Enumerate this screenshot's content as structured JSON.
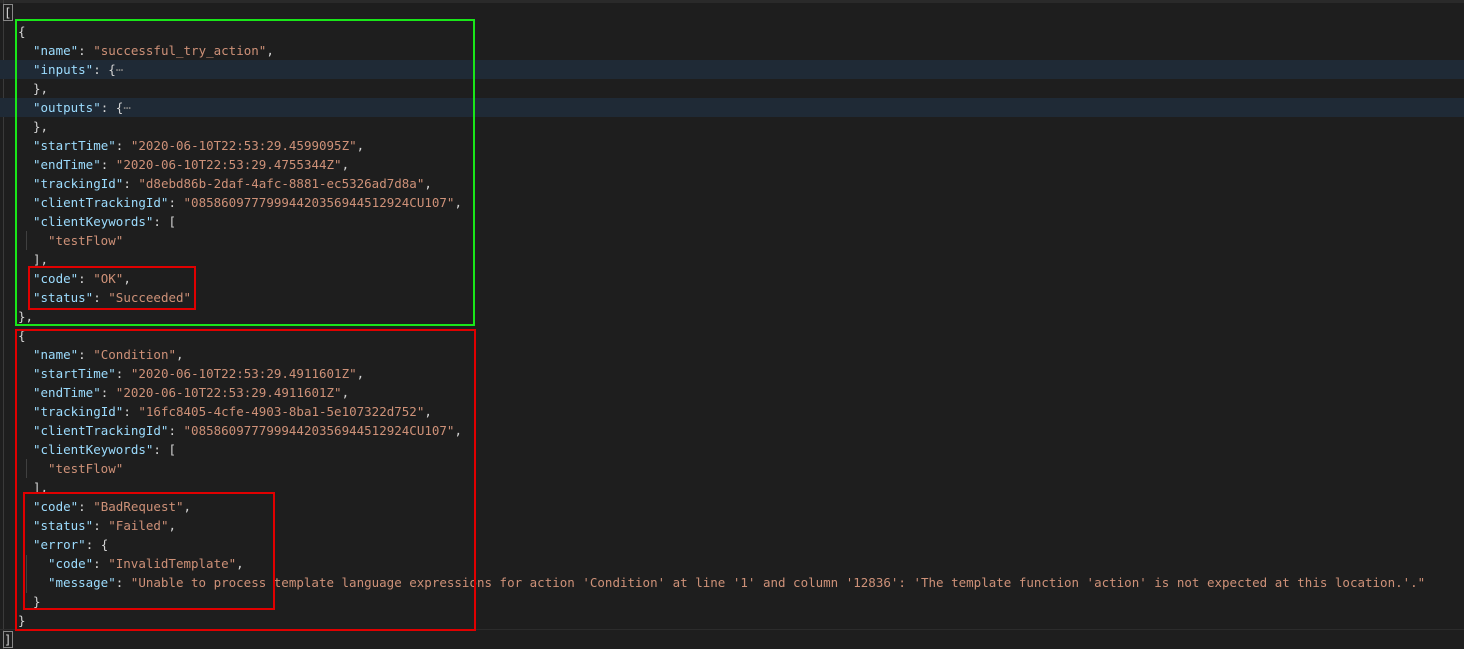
{
  "editor": {
    "open_bracket": "[",
    "close_bracket": "]",
    "fold_ellipsis": "⋯",
    "actions": [
      {
        "name_key": "\"name\"",
        "name_value": "\"successful_try_action\"",
        "inputs_key": "\"inputs\"",
        "outputs_key": "\"outputs\"",
        "startTime_key": "\"startTime\"",
        "startTime_value": "\"2020-06-10T22:53:29.4599095Z\"",
        "endTime_key": "\"endTime\"",
        "endTime_value": "\"2020-06-10T22:53:29.4755344Z\"",
        "trackingId_key": "\"trackingId\"",
        "trackingId_value": "\"d8ebd86b-2daf-4afc-8881-ec5326ad7d8a\"",
        "clientTrackingId_key": "\"clientTrackingId\"",
        "clientTrackingId_value": "\"08586097779994420356944512924CU107\"",
        "clientKeywords_key": "\"clientKeywords\"",
        "clientKeywords_values": [
          "\"testFlow\""
        ],
        "code_key": "\"code\"",
        "code_value": "\"OK\"",
        "status_key": "\"status\"",
        "status_value": "\"Succeeded\""
      },
      {
        "name_key": "\"name\"",
        "name_value": "\"Condition\"",
        "startTime_key": "\"startTime\"",
        "startTime_value": "\"2020-06-10T22:53:29.4911601Z\"",
        "endTime_key": "\"endTime\"",
        "endTime_value": "\"2020-06-10T22:53:29.4911601Z\"",
        "trackingId_key": "\"trackingId\"",
        "trackingId_value": "\"16fc8405-4cfe-4903-8ba1-5e107322d752\"",
        "clientTrackingId_key": "\"clientTrackingId\"",
        "clientTrackingId_value": "\"08586097779994420356944512924CU107\"",
        "clientKeywords_key": "\"clientKeywords\"",
        "clientKeywords_values": [
          "\"testFlow\""
        ],
        "code_key": "\"code\"",
        "code_value": "\"BadRequest\"",
        "status_key": "\"status\"",
        "status_value": "\"Failed\"",
        "error_key": "\"error\"",
        "error_code_key": "\"code\"",
        "error_code_value": "\"InvalidTemplate\"",
        "error_message_key": "\"message\"",
        "error_message_value": "\"Unable to process template language expressions for action 'Condition' at line '1' and column '12836': 'The template function 'action' is not expected at this location.'.\""
      }
    ]
  },
  "annotations": {
    "success_color": "#19e619",
    "failure_color": "#e00000"
  }
}
